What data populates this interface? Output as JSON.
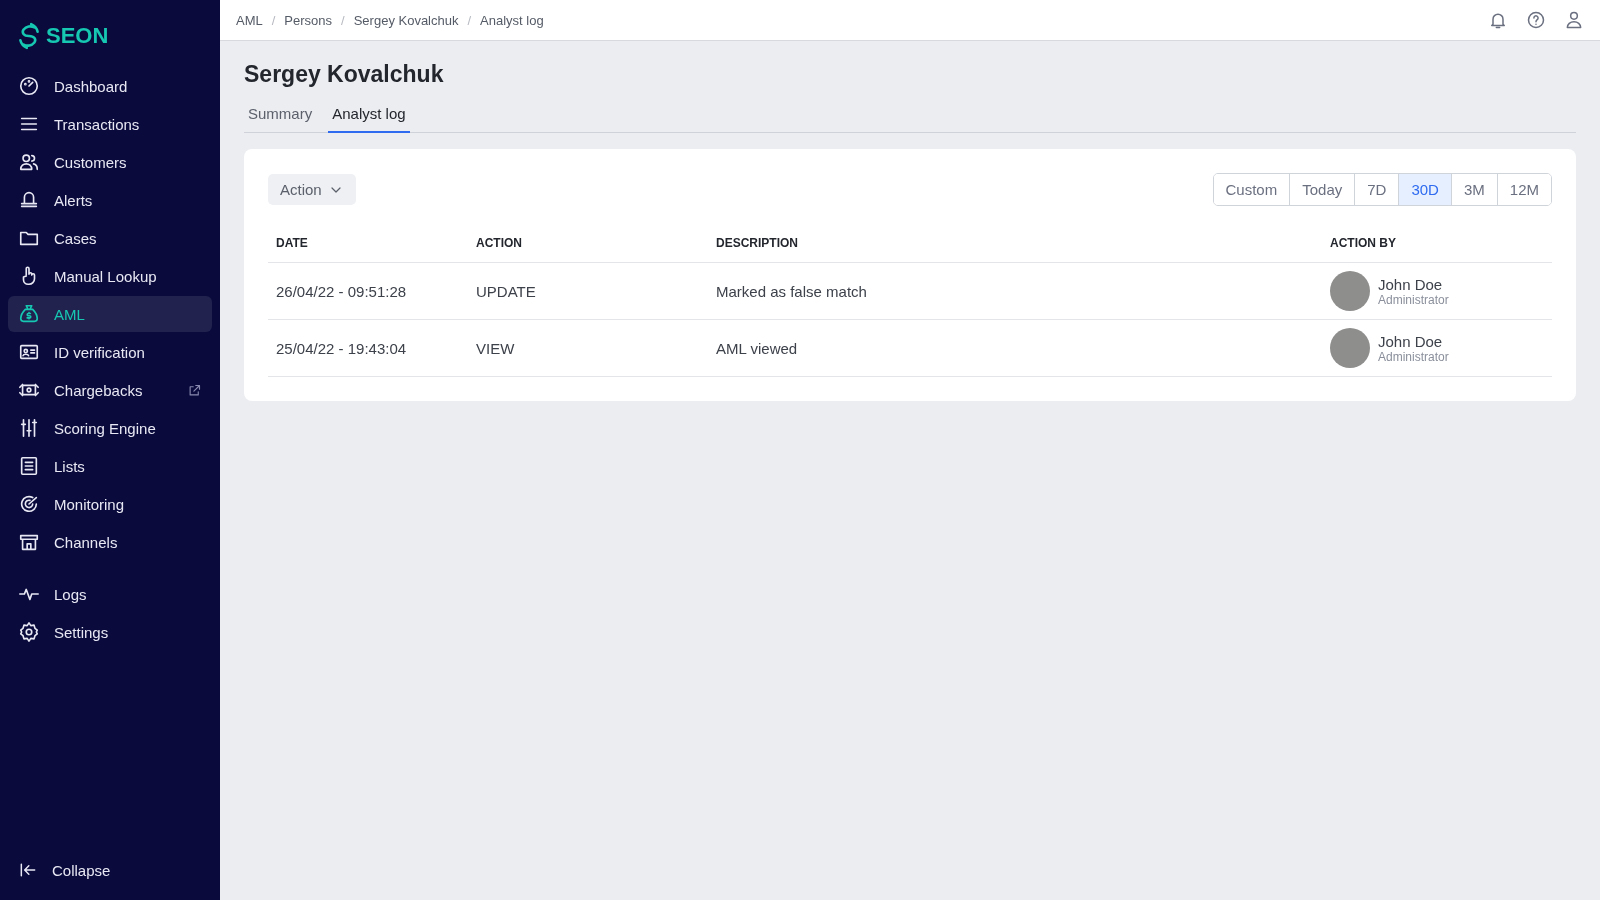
{
  "brand": {
    "name": "SEON"
  },
  "nav": {
    "main": [
      {
        "label": "Dashboard",
        "selected": false,
        "external": false
      },
      {
        "label": "Transactions",
        "selected": false,
        "external": false
      },
      {
        "label": "Customers",
        "selected": false,
        "external": false
      },
      {
        "label": "Alerts",
        "selected": false,
        "external": false
      },
      {
        "label": "Cases",
        "selected": false,
        "external": false
      },
      {
        "label": "Manual Lookup",
        "selected": false,
        "external": false
      },
      {
        "label": "AML",
        "selected": true,
        "external": false
      },
      {
        "label": "ID verification",
        "selected": false,
        "external": false
      },
      {
        "label": "Chargebacks",
        "selected": false,
        "external": true
      },
      {
        "label": "Scoring Engine",
        "selected": false,
        "external": false
      },
      {
        "label": "Lists",
        "selected": false,
        "external": false
      },
      {
        "label": "Monitoring",
        "selected": false,
        "external": false
      },
      {
        "label": "Channels",
        "selected": false,
        "external": false
      }
    ],
    "secondary": [
      {
        "label": "Logs",
        "selected": false,
        "external": false
      },
      {
        "label": "Settings",
        "selected": false,
        "external": false
      }
    ],
    "collapse": "Collapse"
  },
  "breadcrumbs": [
    "AML",
    "Persons",
    "Sergey Kovalchuk",
    "Analyst log"
  ],
  "breadcrumb_separator": "/",
  "page_title": "Sergey Kovalchuk",
  "tabs": [
    {
      "label": "Summary",
      "selected": false
    },
    {
      "label": "Analyst log",
      "selected": true
    }
  ],
  "filter": {
    "label": "Action"
  },
  "ranges": [
    {
      "label": "Custom",
      "selected": false
    },
    {
      "label": "Today",
      "selected": false
    },
    {
      "label": "7D",
      "selected": false
    },
    {
      "label": "30D",
      "selected": true
    },
    {
      "label": "3M",
      "selected": false
    },
    {
      "label": "12M",
      "selected": false
    }
  ],
  "table": {
    "columns": [
      "DATE",
      "ACTION",
      "DESCRIPTION",
      "ACTION BY"
    ],
    "rows": [
      {
        "date": "26/04/22 - 09:51:28",
        "action": "UPDATE",
        "description": "Marked as false match",
        "user": "John Doe",
        "role": "Administrator"
      },
      {
        "date": "25/04/22 - 19:43:04",
        "action": "VIEW",
        "description": "AML viewed",
        "user": "John Doe",
        "role": "Administrator"
      }
    ]
  }
}
